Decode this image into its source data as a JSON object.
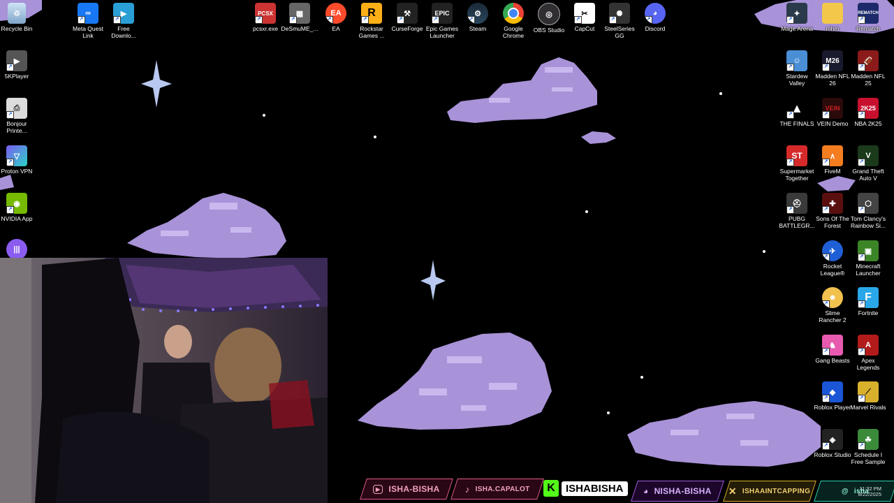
{
  "desktop": {
    "left_column": [
      {
        "label": "Recycle Bin",
        "icon": "recycle-bin-icon"
      },
      {
        "label": "5KPlayer",
        "icon": "5kplayer-icon"
      },
      {
        "label": "Bonjour Printe...",
        "icon": "printer-icon"
      },
      {
        "label": "Proton VPN",
        "icon": "proton-vpn-icon"
      },
      {
        "label": "NVIDIA App",
        "icon": "nvidia-icon"
      }
    ],
    "top_row": [
      {
        "label": "Meta Quest Link",
        "icon": "meta-icon"
      },
      {
        "label": "Free Downlo...",
        "icon": "download-icon"
      },
      {
        "label": "pcsxr.exe",
        "icon": "pcsxr-icon"
      },
      {
        "label": "DeSmuME_...",
        "icon": "desmume-icon"
      },
      {
        "label": "EA",
        "icon": "ea-icon"
      },
      {
        "label": "Rockstar Games ...",
        "icon": "rockstar-icon"
      },
      {
        "label": "CurseForge",
        "icon": "curseforge-icon"
      },
      {
        "label": "Epic Games Launcher",
        "icon": "epic-games-icon"
      },
      {
        "label": "Steam",
        "icon": "steam-icon"
      },
      {
        "label": "Google Chrome",
        "icon": "chrome-icon"
      },
      {
        "label": "OBS Studio",
        "icon": "obs-icon"
      },
      {
        "label": "CapCut",
        "icon": "capcut-icon"
      },
      {
        "label": "SteelSeries GG",
        "icon": "steelseries-icon"
      },
      {
        "label": "Discord",
        "icon": "discord-icon"
      }
    ],
    "right_grid": [
      {
        "label": "Mage Arena",
        "icon": "mage-arena-icon"
      },
      {
        "label": "mhm",
        "icon": "folder-icon"
      },
      {
        "label": "Rematch",
        "icon": "rematch-icon",
        "text": "REMATCH"
      },
      {
        "label": "Stardew Valley",
        "icon": "stardew-icon"
      },
      {
        "label": "Madden NFL 26",
        "icon": "madden-26-icon",
        "text": "M26"
      },
      {
        "label": "Madden NFL 25",
        "icon": "madden-25-icon"
      },
      {
        "label": "THE FINALS",
        "icon": "the-finals-icon"
      },
      {
        "label": "VEIN Demo",
        "icon": "vein-icon",
        "text": "VEIN"
      },
      {
        "label": "NBA 2K25",
        "icon": "nba2k25-icon",
        "text": "2K25"
      },
      {
        "label": "Supermarket Together",
        "icon": "supermarket-icon",
        "text": "ST"
      },
      {
        "label": "FiveM",
        "icon": "fivem-icon"
      },
      {
        "label": "Grand Theft Auto V",
        "icon": "gta-icon"
      },
      {
        "label": "PUBG BATTLEGR...",
        "icon": "pubg-icon"
      },
      {
        "label": "Sons Of The Forest",
        "icon": "sons-forest-icon"
      },
      {
        "label": "Tom Clancy's Rainbow Si...",
        "icon": "rainbow-six-icon"
      },
      {
        "label": "Rocket League®",
        "icon": "rocket-league-icon"
      },
      {
        "label": "Minecraft Launcher",
        "icon": "minecraft-icon"
      },
      {
        "label": "Slime Rancher 2",
        "icon": "slime-rancher-icon"
      },
      {
        "label": "Fortnite",
        "icon": "fortnite-icon"
      },
      {
        "label": "Gang Beasts",
        "icon": "gang-beasts-icon"
      },
      {
        "label": "Apex Legends",
        "icon": "apex-icon"
      },
      {
        "label": "Roblox Player",
        "icon": "roblox-player-icon"
      },
      {
        "label": "Marvel Rivals",
        "icon": "marvel-rivals-icon"
      },
      {
        "label": "Roblox Studio",
        "icon": "roblox-studio-icon"
      },
      {
        "label": "Schedule I Free Sample",
        "icon": "schedule-icon"
      }
    ]
  },
  "icon_texts": {
    "pcsxr": "PCSX",
    "epic": "EPIC"
  },
  "socials": [
    {
      "platform": "youtube",
      "handle": "ISHA-BISHA",
      "color": "#e15a8a"
    },
    {
      "platform": "tiktok",
      "handle": "ISHA.CAPALOT",
      "color": "#e15a8a"
    },
    {
      "platform": "kick",
      "handle": "ISHABISHA",
      "color": "#53fc18"
    },
    {
      "platform": "discord",
      "handle": "NISHA-BISHA",
      "color": "#a05ae0"
    },
    {
      "platform": "x",
      "handle": "ISHAAINTCAPPING",
      "color": "#d9b02c"
    },
    {
      "platform": "threads",
      "handle": "isha",
      "color": "#2bd1b0"
    }
  ],
  "tray": {
    "time": "11:32 PM",
    "date": "8/22/2025"
  },
  "colors": {
    "cloud": "#a892d8",
    "cloud_light": "#c8b8ee",
    "background": "#000000"
  }
}
